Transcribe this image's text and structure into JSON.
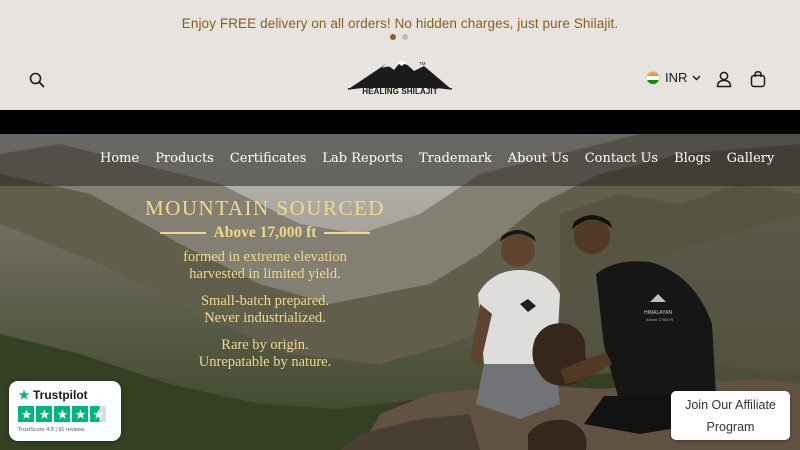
{
  "announcement": {
    "text": "Enjoy FREE delivery on all orders! No hidden charges, just pure Shilajit."
  },
  "header": {
    "logo_text": "HEALING SHILAJIT",
    "logo_tm": "TM",
    "currency": "INR"
  },
  "nav": {
    "items": [
      {
        "label": "Home"
      },
      {
        "label": "Products"
      },
      {
        "label": "Certificates"
      },
      {
        "label": "Lab Reports"
      },
      {
        "label": "Trademark"
      },
      {
        "label": "About Us"
      },
      {
        "label": "Contact Us"
      },
      {
        "label": "Blogs"
      },
      {
        "label": "Gallery"
      }
    ]
  },
  "hero": {
    "title": "MOUNTAIN SOURCED",
    "subtitle": "Above 17,000 ft",
    "line1": "formed in extreme elevation",
    "line2": "harvested in limited yield.",
    "line3": "Small-batch prepared.",
    "line4": "Never industrialized.",
    "line5": "Rare by origin.",
    "line6": "Unrepatable by nature.",
    "shirt_text_1": "HIMALAYAN",
    "shirt_text_2": "Above 17000 ft"
  },
  "trustpilot": {
    "brand": "Trustpilot",
    "score_text": "TrustScore 4.8 | 91 reviews",
    "rating": 4.6
  },
  "affiliate": {
    "line1": "Join Our Affiliate",
    "line2": "Program"
  },
  "colors": {
    "announcement_text": "#8a5d1c",
    "hero_text": "#f2d88a",
    "trustpilot_green": "#00b67a"
  }
}
